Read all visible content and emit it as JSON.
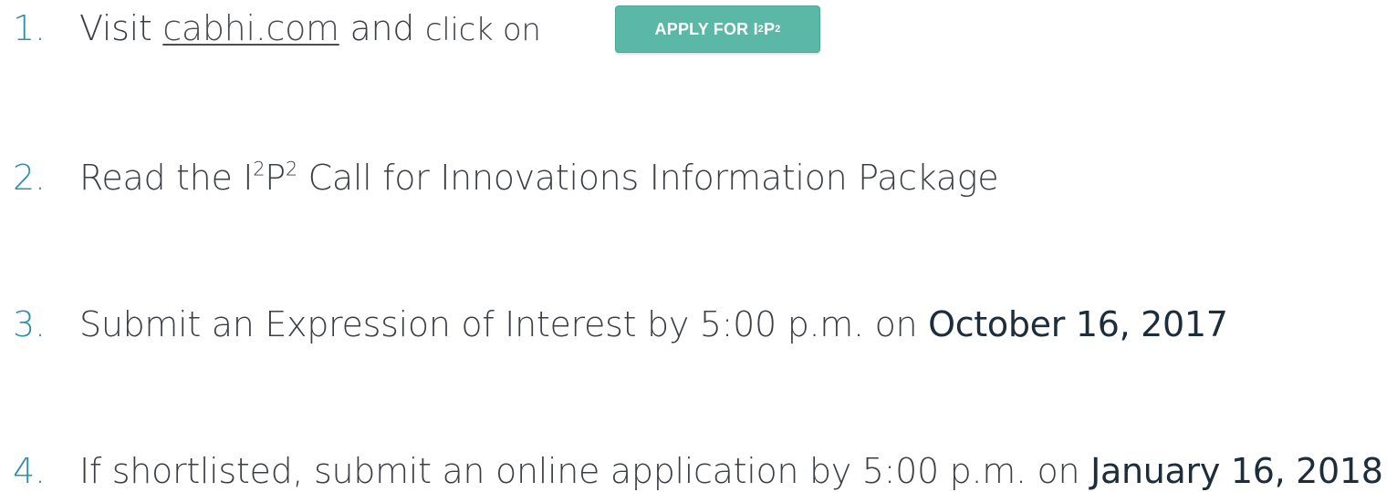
{
  "steps": [
    {
      "number": "1.",
      "visit": "Visit ",
      "link": "cabhi.com",
      "and": " and ",
      "click": "click on",
      "button": {
        "label": "APPLY FOR I",
        "sup1": "2",
        "p": "P",
        "sup2": "2"
      }
    },
    {
      "number": "2.",
      "pre": "Read the I",
      "sup1": "2",
      "p": "P",
      "sup2": "2",
      "post": " Call for Innovations Information Package"
    },
    {
      "number": "3.",
      "text": "Submit an Expression of Interest by 5:00 p.m. on ",
      "date": "October 16, 2017"
    },
    {
      "number": "4.",
      "text": "If shortlisted, submit an online application by 5:00 p.m. on ",
      "date": "January 16, 2018"
    }
  ],
  "colors": {
    "number": "#2e8fa6",
    "text": "#3b3f44",
    "date": "#1e2d3a",
    "button": "#5bb8a6"
  }
}
